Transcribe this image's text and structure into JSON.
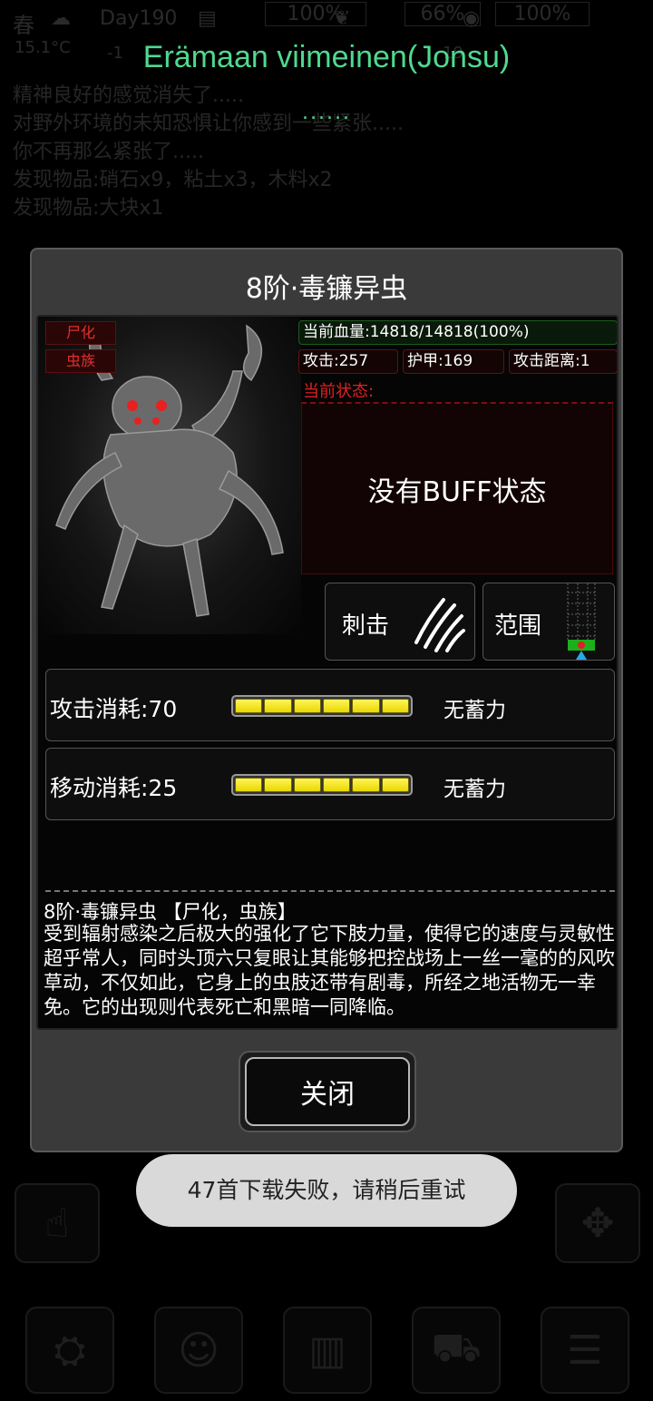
{
  "status_bar": {
    "season": "春",
    "day": "Day190",
    "temperature": "15.1°C",
    "temp_delta": "-1",
    "stat1": "100%",
    "stat2": "66%",
    "stat3": "100%",
    "stat2_sub": "19"
  },
  "music": {
    "title": "Erämaan viimeinen(Jonsu)",
    "dots": "......"
  },
  "log": [
    "精神良好的感觉消失了.....",
    "对野外环境的未知恐惧让你感到一些紧张.....",
    "你不再那么紧张了.....",
    "发现物品:硝石x9，粘土x3，木料x2",
    "发现物品:大块x1"
  ],
  "dialog": {
    "title": "8阶·毒镰异虫",
    "tags": [
      "尸化",
      "虫族"
    ],
    "hp": "当前血量:14818/14818(100%)",
    "attack": "攻击:257",
    "armor": "护甲:169",
    "range": "攻击距离:1",
    "state_label": "当前状态:",
    "no_buff": "没有BUFF状态",
    "skill_attack": "刺击",
    "skill_range": "范围",
    "attack_cost": "攻击消耗:70",
    "move_cost": "移动消耗:25",
    "charge_status": "无蓄力",
    "attack_charge_level": 1.0,
    "move_charge_level": 1.0,
    "desc_title": "8阶·毒镰异虫 【尸化，虫族】",
    "description": "受到辐射感染之后极大的强化了它下肢力量，使得它的速度与灵敏性超乎常人，同时头顶六只复眼让其能够把控战场上一丝一毫的的风吹草动，不仅如此，它身上的虫肢还带有剧毒，所经之地活物无一幸免。它的出现则代表死亡和黑暗一同降临。",
    "close": "关闭"
  },
  "toast": "47首下载失败，请稍后重试",
  "colors": {
    "music_title": "#4fd98f",
    "state_label": "#e02020",
    "bar_fill": "#fff45a"
  }
}
